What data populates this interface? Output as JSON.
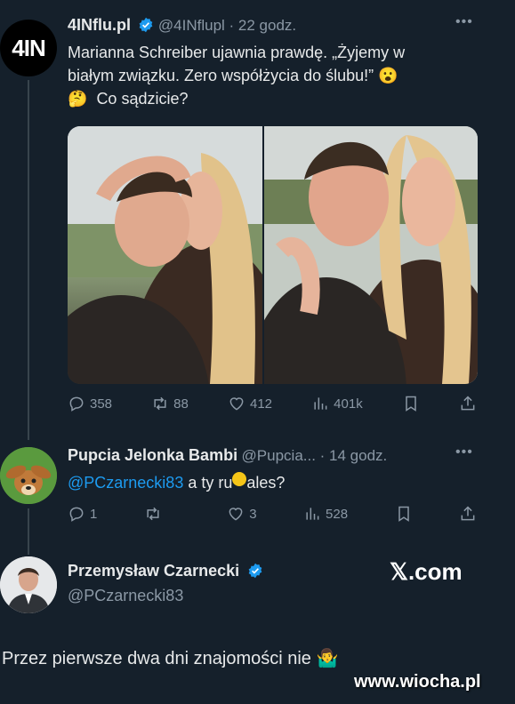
{
  "tweet1": {
    "avatar_text": "4IN",
    "display_name": "4INflu.pl",
    "handle": "@4INflupl",
    "time": "22 godz.",
    "text_line1": "Marianna Schreiber ujawnia prawdę. „Żyjemy w",
    "text_line2": "białym związku. Zero współżycia do ślubu!”",
    "text_line3": "Co sądzicie?",
    "emoji1": "😮",
    "emoji2": "🤔",
    "stats": {
      "replies": "358",
      "retweets": "88",
      "likes": "412",
      "views": "401k"
    }
  },
  "tweet2": {
    "display_name": "Pupcia Jelonka Bambi",
    "handle": "@Pupcia...",
    "time": "14 godz.",
    "mention": "@PCzarnecki83",
    "text_a": " a ty ru",
    "text_b": "ales?",
    "stats": {
      "replies": "1",
      "retweets": "",
      "likes": "3",
      "views": "528"
    }
  },
  "tweet3": {
    "display_name": "Przemysław Czarnecki",
    "handle": "@PCzarnecki83",
    "x_brand": "𝕏.com"
  },
  "caption": "Przez pierwsze dwa dni znajomości nie",
  "caption_emoji": "🤷‍♂️",
  "watermark": "www.wiocha.pl",
  "colors": {
    "bg": "#15202b",
    "link": "#1d9bf0",
    "verified": "#1d9bf0",
    "muted": "#8b98a5"
  }
}
